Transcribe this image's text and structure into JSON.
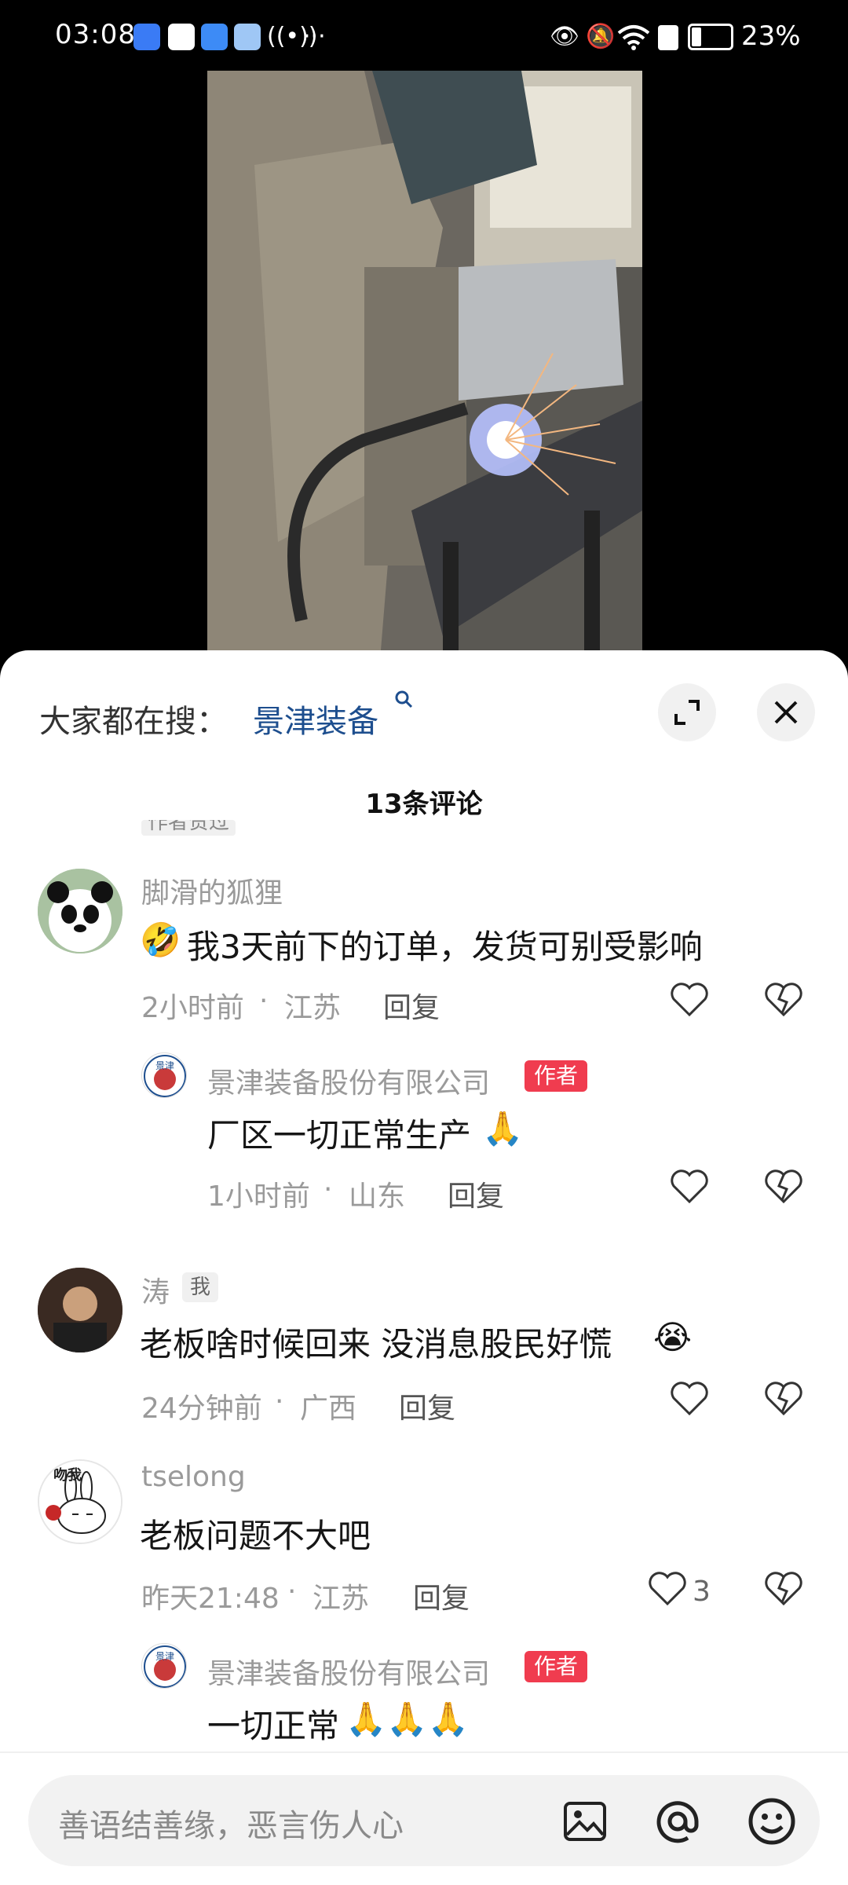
{
  "status_bar": {
    "time": "03:08",
    "battery": "23%",
    "icons": [
      "eye-icon",
      "mute-icon",
      "wifi-icon",
      "alert-icon",
      "battery-icon"
    ]
  },
  "search_bar": {
    "prefix": "大家都在搜：",
    "keyword": "景津装备"
  },
  "comments_header": "13条评论",
  "partial_tag": "作者赞过",
  "comments": [
    {
      "user": "脚滑的狐狸",
      "text": "我3天前下的订单，发货可别受影响",
      "emoji_lead": "🤣",
      "time": "2小时前",
      "location": "江苏",
      "reply": "回复"
    },
    {
      "user": "景津装备股份有限公司",
      "badge": "作者",
      "text": "厂区一切正常生产",
      "emoji_trail": "🙏",
      "time": "1小时前",
      "location": "山东",
      "reply": "回复"
    },
    {
      "user": "涛",
      "badge": "我",
      "text": "老板啥时候回来  没消息股民好慌",
      "emoji_trail": "😭",
      "time": "24分钟前",
      "location": "广西",
      "reply": "回复"
    },
    {
      "user": "tselong",
      "text": "老板问题不大吧",
      "time": "昨天21:48",
      "location": "江苏",
      "reply": "回复",
      "likes": "3"
    },
    {
      "user": "景津装备股份有限公司",
      "badge": "作者",
      "text": "一切正常",
      "emoji_trail": "🙏🙏🙏"
    }
  ],
  "avatar_text": {
    "tselong": "吻我"
  },
  "input": {
    "placeholder": "善语结善缘，恶言伤人心"
  },
  "colors": {
    "author_badge": "#f03c4f",
    "keyword": "#1d4e8e"
  }
}
